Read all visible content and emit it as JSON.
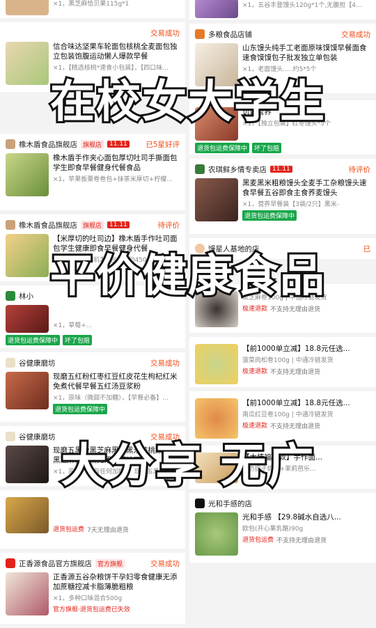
{
  "overlay": {
    "line1": "在校女大学生",
    "line2": "平价健康食品",
    "line3": "大分享 无广"
  },
  "left_cards": [
    {
      "shop": "",
      "badge": "",
      "status": "",
      "title": "",
      "sku": "×1，黑芝麻恰贝果115g*1",
      "tags": []
    },
    {
      "shop": "",
      "badge": "",
      "status": "交易成功",
      "title": "信合味达坚果车轮面包核桃全麦面包独立包装饱腹运动懒人爆款早餐",
      "sku": "×1，【精选核桃*速食小包装】，【四口味...",
      "tags": []
    },
    {
      "shop": "橡木盾食品旗舰店",
      "badge": "旗舰店",
      "badge2": "11.11",
      "status": "已5星好评",
      "title": "橡木盾手作夹心面包厚切吐司手撕面包学生即食早餐健身代餐食品",
      "sku": "×1，苹果板栗卷卷包+抹茶米厚切+柠檬...",
      "tags": []
    },
    {
      "shop": "橡木盾食品旗舰店",
      "badge": "旗舰店",
      "badge2": "11.11",
      "status": "待评价",
      "title": "【米厚切的吐司边】橡木盾手作吐司面包学生健康即食早餐健身代餐",
      "sku": "×1，多口味随机发4包8片,约450g",
      "tags": []
    },
    {
      "shop": "林小",
      "badge": "",
      "status": "",
      "title": "",
      "sku": "×1，草莓+...",
      "tags": [
        "退货包运费保障中",
        "坏了包赔"
      ]
    },
    {
      "shop": "谷健康磨坊",
      "badge": "",
      "status": "交易成功",
      "title": "现磨五红粉红枣红豆红皮花生枸杞红米免煮代餐早餐五红汤豆浆粉",
      "sku": "×1，原味（微甜不加糖），【早餐必备】...",
      "tags": [
        "退货包运费保障中"
      ]
    },
    {
      "shop": "谷健康磨坊",
      "badge": "",
      "status": "交易成功",
      "title": "现磨五黑粉黑芝麻黑豆黑米核桃黑桑葚黑芝麻糊免煮无添加原味五谷",
      "sku": "×1，原味（没有任何加糖），现磨五黑粉500...",
      "tags": []
    },
    {
      "shop": "",
      "badge": "",
      "status": "",
      "title": "",
      "sku": "",
      "tags": [
        "退货包运费",
        "7天无理由退货"
      ]
    },
    {
      "shop": "正香源食品官方旗舰店",
      "badge": "官方旗舰",
      "status": "交易成功",
      "title": "正香源五谷杂粮饼干孕妇零食健康无添加蔗糖控减卡脂薄脆粗粮",
      "sku": "×1，多种口味混合500g",
      "tags": [
        "官方旗舰·退货包运费已失效"
      ]
    }
  ],
  "right_cards": [
    {
      "shop": "",
      "badge": "",
      "status": "",
      "title": "",
      "sku": "×1，五谷丰登馒头120g*1个,无腹担【4...",
      "tags": []
    },
    {
      "shop": "多粮食品店铺",
      "badge": "",
      "status": "交易成功",
      "title": "山东馒头纯手工老面原味馍馍早餐面食速食馍馍包子批发独立单包装",
      "sku": "×1，老面馒头.....约5*5个",
      "tags": []
    },
    {
      "shop": "",
      "badge": "",
      "status": "",
      "title": "饥饿营养",
      "sku": "×1，【独立包装】红枣馒头*5个",
      "tags": [
        "退货包运费保障中",
        "坏了包赔"
      ]
    },
    {
      "shop": "农琪鲜乡情专卖店",
      "badge": "11.11",
      "status": "待评价",
      "title": "黑麦黑米粗粮馒头全麦手工杂粮馒头速食早餐五谷即食主食荞麦馒头",
      "sku": "×1，营养早餐装【3袋/2只】黑米-",
      "tags": [
        "退货包运费保障中"
      ]
    },
    {
      "shop": "馒星人基地的店",
      "badge": "",
      "status": "已",
      "title": "",
      "sku": "",
      "tags": []
    },
    {
      "shop": "",
      "badge": "",
      "status": "",
      "title": "",
      "sku": "黑芝麻卷100g | 中通冷链发货",
      "tags": [
        "极速退款",
        "不支持无理由退货"
      ]
    },
    {
      "shop": "",
      "badge": "",
      "status": "",
      "title": "【前1000单立减】18.8元任选...",
      "sku": "菠菜肉松卷100g | 中通冷链发货",
      "tags": [
        "极速退款",
        "不支持无理由退货"
      ]
    },
    {
      "shop": "",
      "badge": "",
      "status": "",
      "title": "【前1000单立减】18.8元任选...",
      "sku": "南瓜红豆卷100g | 中通冷链发货",
      "tags": [
        "极速退款",
        "不支持无理由退货"
      ]
    },
    {
      "shop": "",
      "badge": "",
      "status": "",
      "title": "【木棒福利款】手作面...",
      "sku": "...奶提子奶酪+茉莉芭乐...",
      "tags": []
    },
    {
      "shop": "光和手感的店",
      "badge": "",
      "status": "",
      "title": "光和手感 【29.8碱水自选八...",
      "sku": "欧包(开心果乳酪)90g",
      "tags": [
        "退货包运费",
        "不支持无理由退货"
      ]
    }
  ]
}
